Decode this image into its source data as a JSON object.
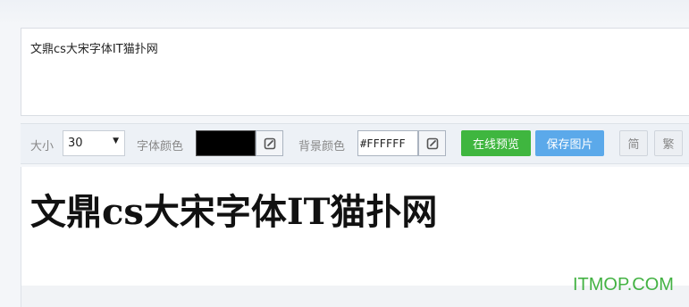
{
  "input": {
    "text": "文鼎cs大宋字体IT猫扑网"
  },
  "toolbar": {
    "size_label": "大小",
    "size_value": "30",
    "font_color_label": "字体颜色",
    "font_color": "#000000",
    "bg_color_label": "背景颜色",
    "bg_color_value": "#FFFFFF",
    "preview_button": "在线预览",
    "save_button": "保存图片",
    "simplified_button": "简",
    "traditional_button": "繁"
  },
  "preview": {
    "text": "文鼎cs大宋字体IT猫扑网"
  },
  "watermark": "ITMOP.COM",
  "colors": {
    "preview_button_bg": "#3fb63f",
    "save_button_bg": "#5ba9ea",
    "watermark": "#43b243"
  }
}
